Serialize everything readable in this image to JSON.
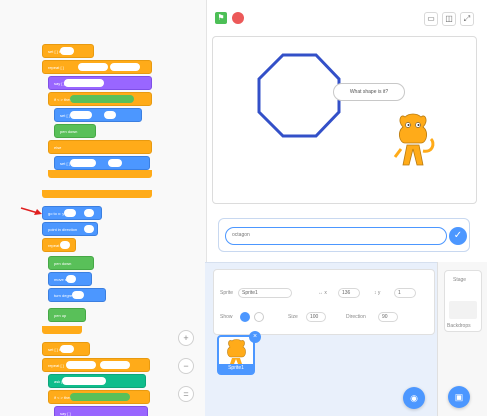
{
  "code": {
    "blocks": [
      {
        "label": "set [ ] to",
        "color": "orange"
      },
      {
        "label": "repeat [ ]",
        "color": "orange"
      },
      {
        "label": "say [ ]",
        "color": "purple"
      },
      {
        "label": "if < > then",
        "color": "orange"
      },
      {
        "label": "set [ ] to",
        "color": "blue"
      },
      {
        "label": "pen down",
        "color": "green"
      },
      {
        "label": "else",
        "color": "orange"
      },
      {
        "label": "set [ ] to",
        "color": "blue"
      },
      {
        "label": "go to x: y:",
        "color": "blue"
      },
      {
        "label": "point in direction",
        "color": "blue"
      },
      {
        "label": "repeat",
        "color": "orange"
      },
      {
        "label": "pen down",
        "color": "green"
      },
      {
        "label": "move steps",
        "color": "blue"
      },
      {
        "label": "turn degrees",
        "color": "blue"
      },
      {
        "label": "pen up",
        "color": "green"
      },
      {
        "label": "set [ ] to",
        "color": "orange"
      },
      {
        "label": "ask [ ] and wait",
        "color": "teal"
      }
    ],
    "zoom_in": "+",
    "zoom_out": "−",
    "zoom_reset": "="
  },
  "stage": {
    "speech_bubble": "What shape is it?"
  },
  "ask": {
    "answer_value": "octagon"
  },
  "sprite_info": {
    "sprite_label": "Sprite",
    "sprite_name": "Sprite1",
    "x_value": "136",
    "y_value": "1",
    "show_label": "Show",
    "size_label": "Size",
    "size_value": "100",
    "direction_label": "Direction",
    "direction_value": "90"
  },
  "sprite_list": {
    "thumb_label": "Sprite1"
  },
  "stage_pane": {
    "label": "Stage",
    "backdrops_label": "Backdrops"
  }
}
